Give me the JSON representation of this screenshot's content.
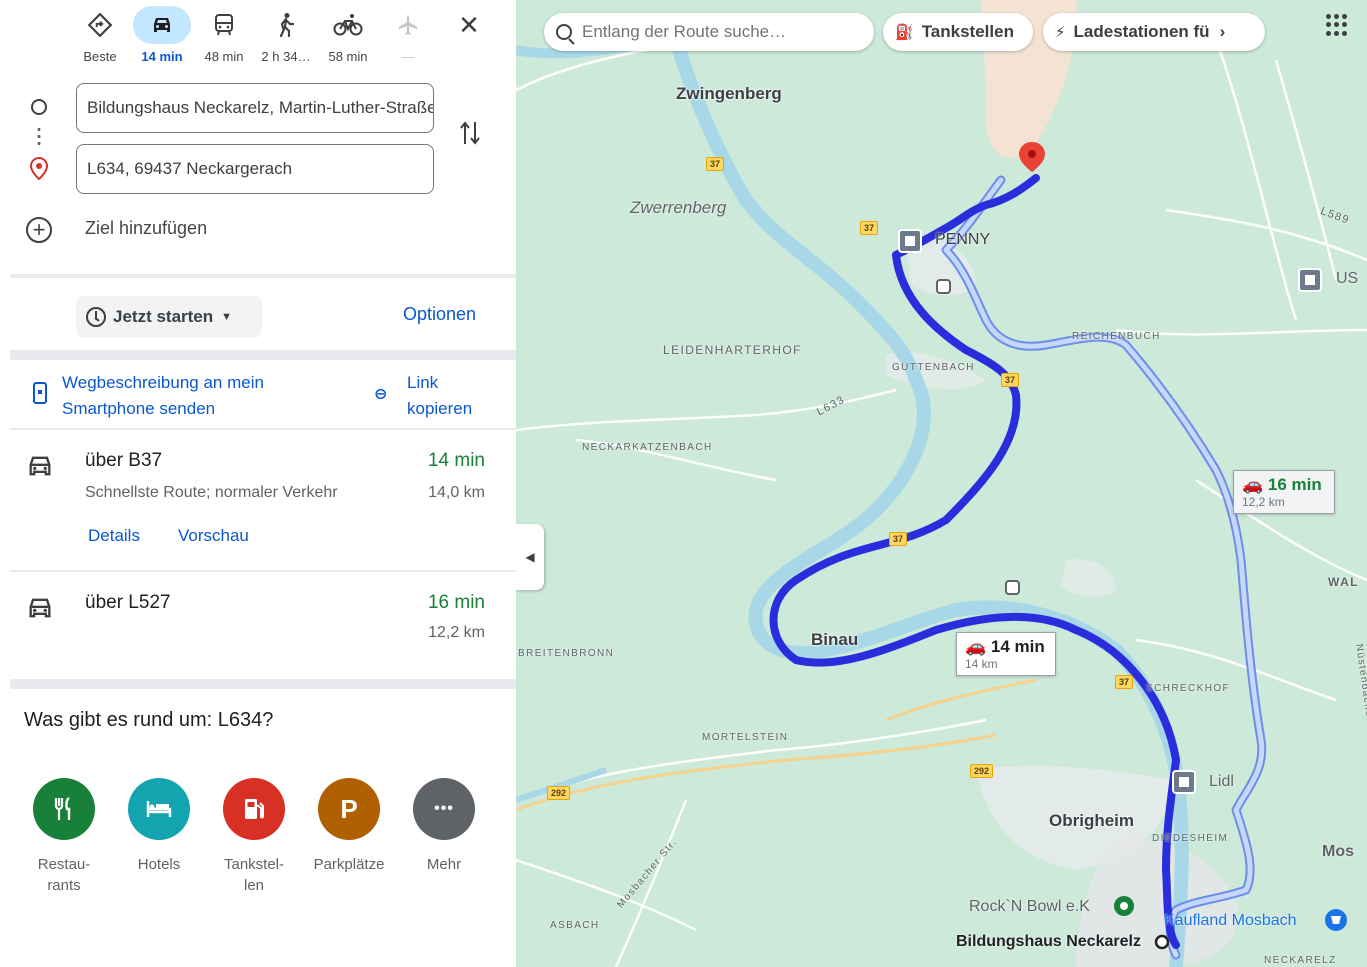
{
  "travel_modes": [
    {
      "name": "best",
      "icon": "directions-icon",
      "label": "Beste",
      "state": "normal"
    },
    {
      "name": "car",
      "icon": "car-icon",
      "label": "14 min",
      "state": "active"
    },
    {
      "name": "transit",
      "icon": "transit-icon",
      "label": "48 min",
      "state": "normal"
    },
    {
      "name": "walk",
      "icon": "walk-icon",
      "label": "2 h 34…",
      "state": "normal"
    },
    {
      "name": "bike",
      "icon": "bike-icon",
      "label": "58 min",
      "state": "normal"
    },
    {
      "name": "flight",
      "icon": "flight-icon",
      "label": "—",
      "state": "disabled"
    }
  ],
  "origin": {
    "value": "Bildungshaus Neckarelz, Martin-Luther-Straße"
  },
  "destination": {
    "value": "L634, 69437 Neckargerach"
  },
  "add_destination": "Ziel hinzufügen",
  "depart": {
    "label": "Jetzt starten"
  },
  "options_label": "Optionen",
  "send_to_phone": "Wegbeschreibung an mein Smartphone senden",
  "copy_link": "Link kopieren",
  "routes": [
    {
      "via": "über B37",
      "description": "Schnellste Route; normaler Verkehr",
      "time": "14 min",
      "distance": "14,0 km",
      "actions": [
        "Details",
        "Vorschau"
      ]
    },
    {
      "via": "über L527",
      "description": "",
      "time": "16 min",
      "distance": "12,2 km",
      "actions": []
    }
  ],
  "nearby": {
    "title": "Was gibt es rund um: L634?",
    "categories": [
      {
        "label": "Restau-\nrants",
        "icon": "restaurant-icon",
        "color": "#188038",
        "glyph": "🍴"
      },
      {
        "label": "Hotels",
        "icon": "hotel-icon",
        "color": "#12a4af",
        "glyph": "🛏"
      },
      {
        "label": "Tankstel-\nlen",
        "icon": "gas-station-icon",
        "color": "#d93025",
        "glyph": "⛽"
      },
      {
        "label": "Parkplätze",
        "icon": "parking-icon",
        "color": "#b06000",
        "glyph": "P"
      },
      {
        "label": "Mehr",
        "icon": "more-icon",
        "color": "#5f6368",
        "glyph": "•••"
      }
    ]
  },
  "map": {
    "search_placeholder": "Entlang der Route suche…",
    "chips": [
      "Tankstellen",
      "Ladestationen fü"
    ],
    "bubble_primary": {
      "time": "14 min",
      "distance": "14 km"
    },
    "bubble_alt": {
      "time": "16 min",
      "distance": "12,2 km"
    },
    "towns": [
      "Zwingenberg",
      "Zwerrenberg",
      "Binau",
      "Obrigheim"
    ],
    "areas": [
      "LEIDENHARTERHOF",
      "GUTTENBACH",
      "NECKARKATZENBACH",
      "REICHENBUCH",
      "BREITENBRONN",
      "MORTELSTEIN",
      "SCHRECKHOF",
      "DIEDESHEIM",
      "ASBACH",
      "NECKARELZ",
      "WAL"
    ],
    "pois": [
      "PENNY",
      "Lidl",
      "Rock`N Bowl e.K",
      "Kaufland Mosbach",
      "Bildungshaus Neckarelz",
      "US",
      "Mos"
    ],
    "roads": [
      "37",
      "292",
      "L633",
      "L589",
      "Mosbacher Str.",
      "Nüstenbacher Str."
    ],
    "colors": {
      "route": "#2a2ddb",
      "alt_route": "#8ab4f8",
      "river": "#a8d8e8",
      "land": "#cde9d9",
      "accent": "#0b57d0",
      "time_green": "#188038"
    }
  }
}
